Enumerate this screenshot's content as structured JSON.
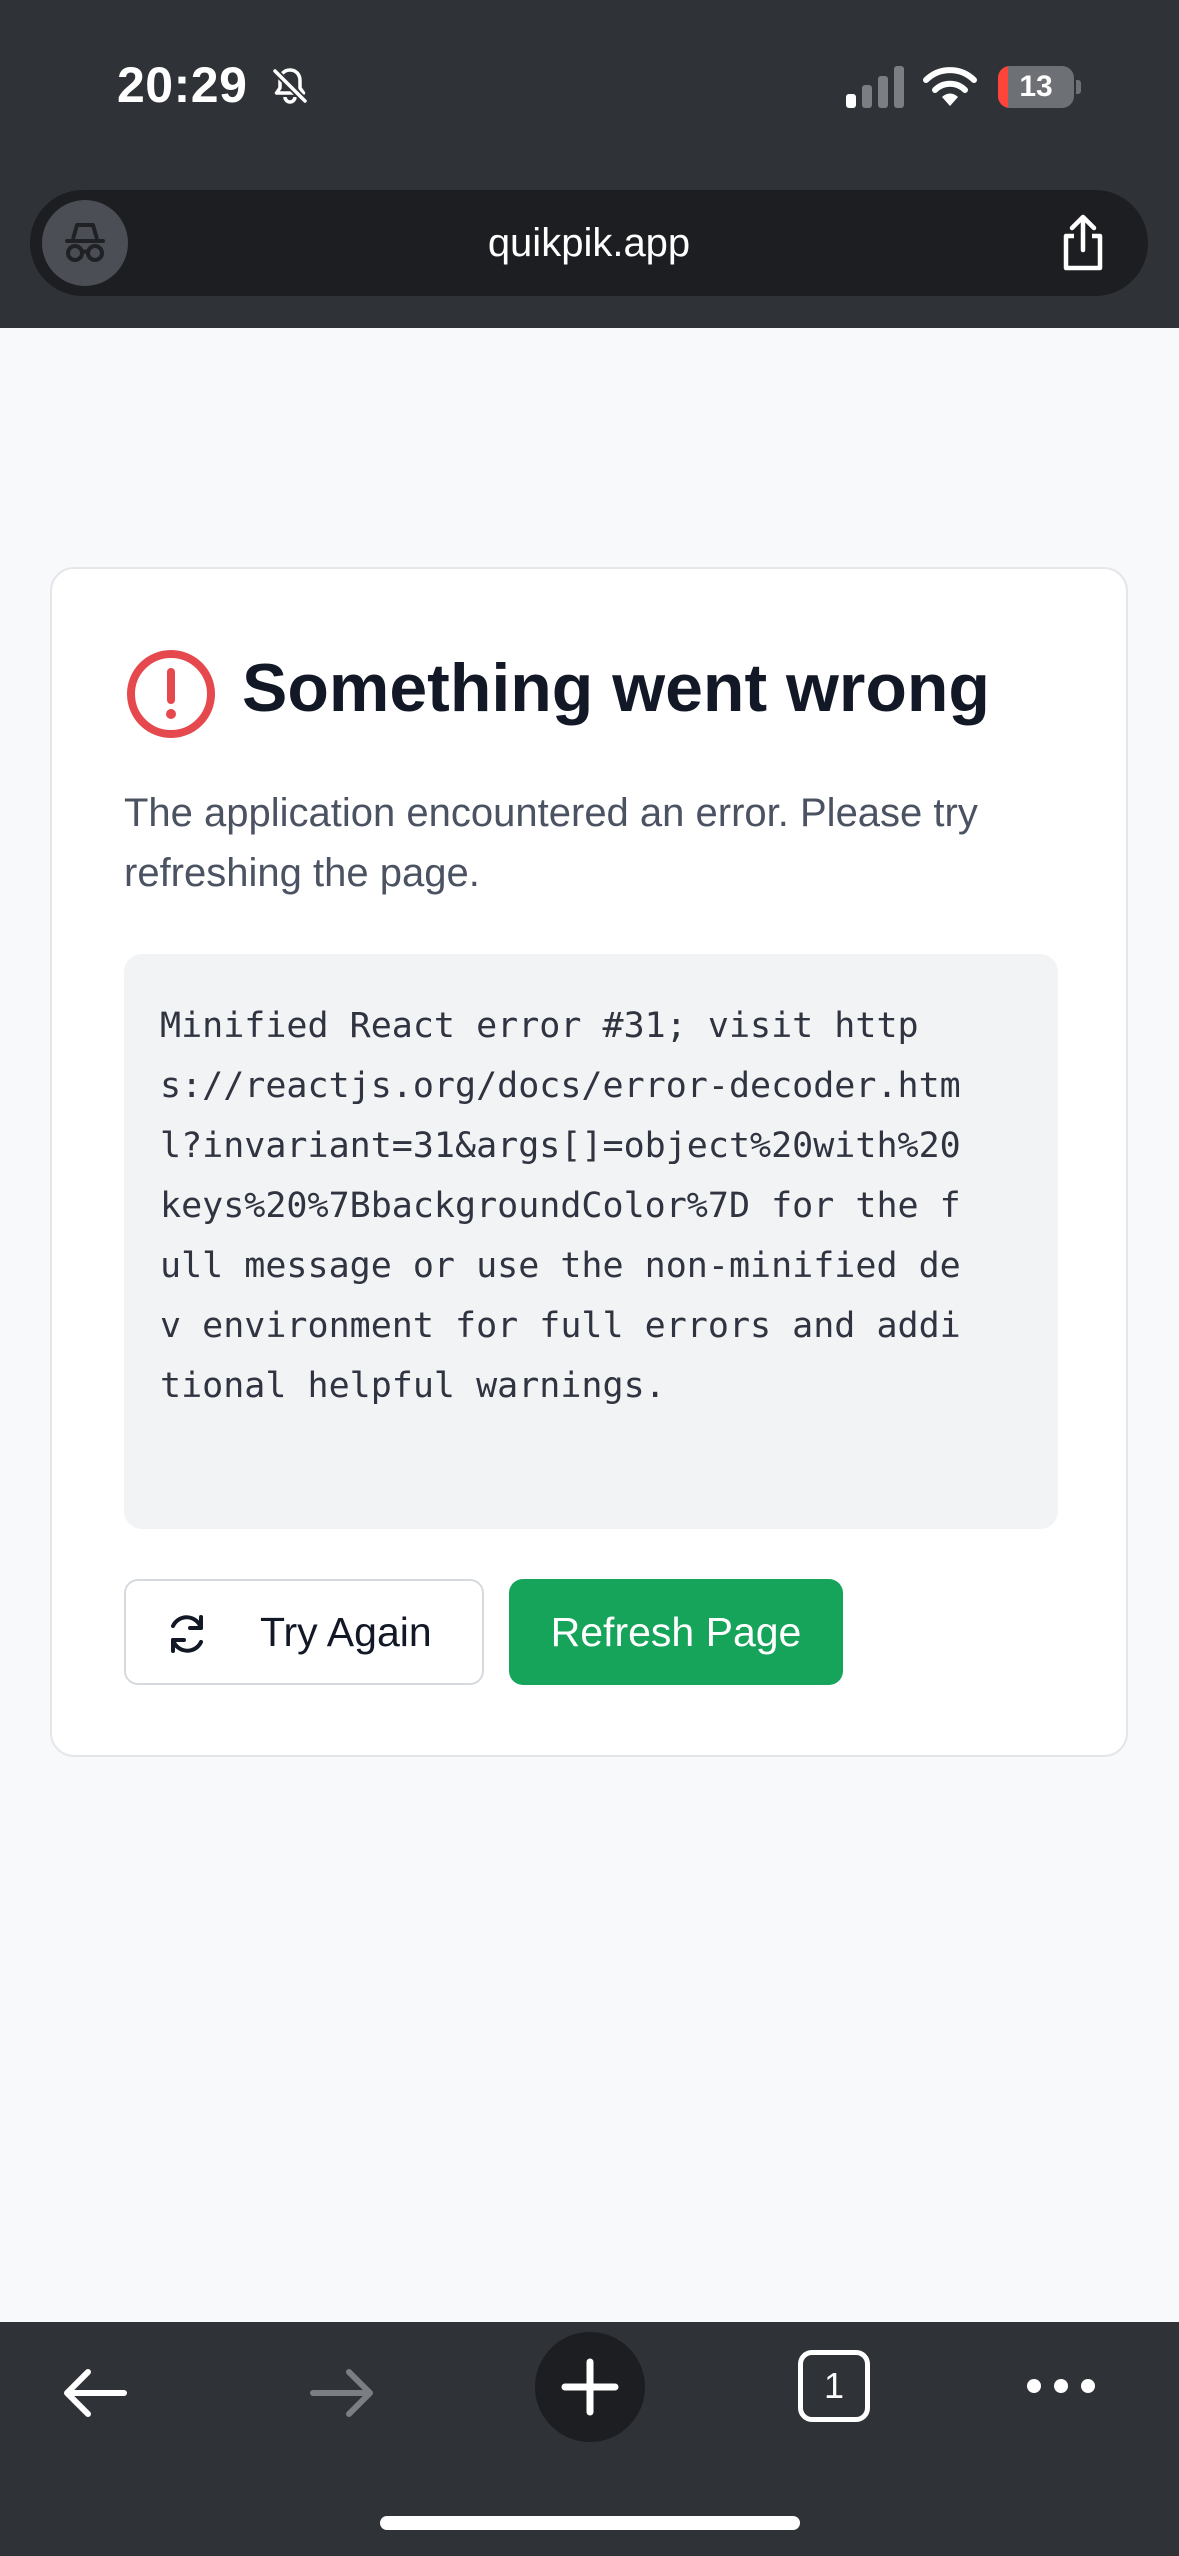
{
  "status_bar": {
    "time": "20:29",
    "battery_level": "13",
    "battery_fraction": 0.13
  },
  "browser": {
    "url": "quikpik.app",
    "tab_count": "1"
  },
  "error_card": {
    "title": "Something went wrong",
    "description": "The application encountered an error. Please try refreshing the page.",
    "code_lines": [
      "Minified React error #31; visit http",
      "s://reactjs.org/docs/error-decoder.htm",
      "l?invariant=31&args[]=object%20with%20",
      "keys%20%7BbackgroundColor%7D for the f",
      "ull message or use the non-minified de",
      "v environment for full errors and addi",
      "tional helpful warnings."
    ],
    "try_again_label": "Try Again",
    "refresh_label": "Refresh Page"
  },
  "colors": {
    "error_red": "#e5484d",
    "accent_green": "#16a35a",
    "toolbar_bg": "#2f3237"
  }
}
